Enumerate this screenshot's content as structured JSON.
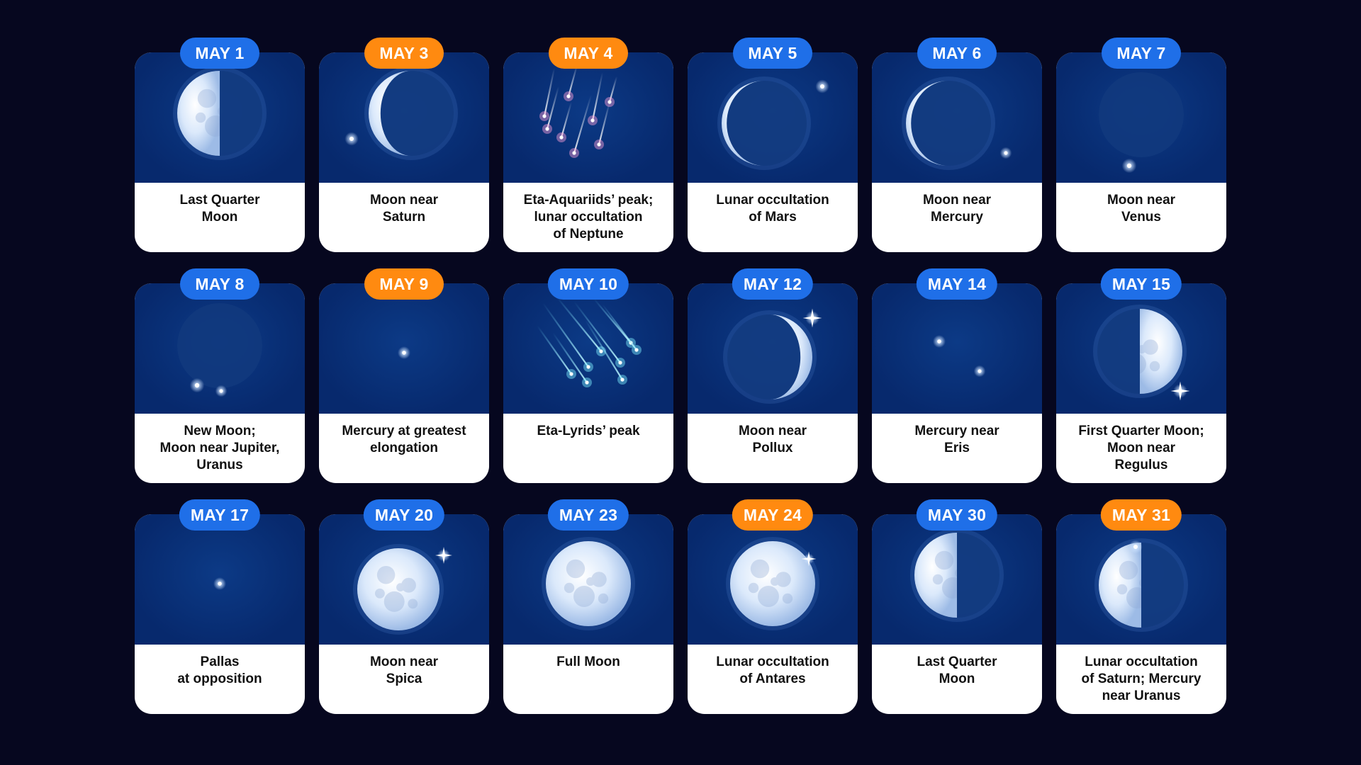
{
  "events": [
    {
      "date": "MAY 1",
      "label": "Last Quarter\nMoon",
      "accent": "blue",
      "scene": "last-quarter-moon"
    },
    {
      "date": "MAY 3",
      "label": "Moon near\nSaturn",
      "accent": "orange",
      "scene": "crescent-moon-with-planet"
    },
    {
      "date": "MAY 4",
      "label": "Eta-Aquariids’ peak;\nlunar occultation\nof Neptune",
      "accent": "orange",
      "scene": "meteor-shower-pink"
    },
    {
      "date": "MAY 5",
      "label": "Lunar occultation\nof Mars",
      "accent": "blue",
      "scene": "thin-crescent-with-planet"
    },
    {
      "date": "MAY 6",
      "label": "Moon near\nMercury",
      "accent": "blue",
      "scene": "thin-crescent-with-planet"
    },
    {
      "date": "MAY 7",
      "label": "Moon near\nVenus",
      "accent": "blue",
      "scene": "dark-moon-with-planet"
    },
    {
      "date": "MAY 8",
      "label": "New Moon;\nMoon near Jupiter,\nUranus",
      "accent": "blue",
      "scene": "new-moon-with-planets"
    },
    {
      "date": "MAY 9",
      "label": "Mercury at greatest\nelongation",
      "accent": "orange",
      "scene": "single-star"
    },
    {
      "date": "MAY 10",
      "label": "Eta-Lyrids’ peak",
      "accent": "blue",
      "scene": "meteor-shower-cyan"
    },
    {
      "date": "MAY 12",
      "label": "Moon near\nPollux",
      "accent": "blue",
      "scene": "waxing-crescent-with-star"
    },
    {
      "date": "MAY 14",
      "label": "Mercury near\nEris",
      "accent": "blue",
      "scene": "two-stars"
    },
    {
      "date": "MAY 15",
      "label": "First Quarter Moon;\nMoon near\nRegulus",
      "accent": "blue",
      "scene": "first-quarter-moon-with-star"
    },
    {
      "date": "MAY 17",
      "label": "Pallas\nat opposition",
      "accent": "blue",
      "scene": "single-star"
    },
    {
      "date": "MAY 20",
      "label": "Moon near\nSpica",
      "accent": "blue",
      "scene": "gibbous-moon-with-star"
    },
    {
      "date": "MAY 23",
      "label": "Full Moon",
      "accent": "blue",
      "scene": "full-moon"
    },
    {
      "date": "MAY 24",
      "label": "Lunar occultation\nof Antares",
      "accent": "orange",
      "scene": "full-moon-with-star"
    },
    {
      "date": "MAY 30",
      "label": "Last Quarter\nMoon",
      "accent": "blue",
      "scene": "last-quarter-moon"
    },
    {
      "date": "MAY 31",
      "label": "Lunar occultation\nof Saturn; Mercury\nnear Uranus",
      "accent": "orange",
      "scene": "half-moon-with-planet"
    }
  ],
  "colors": {
    "background": "#06071f",
    "sky": "#07296d",
    "blue_pill": "#1f6fe8",
    "orange_pill": "#ff8a10"
  }
}
